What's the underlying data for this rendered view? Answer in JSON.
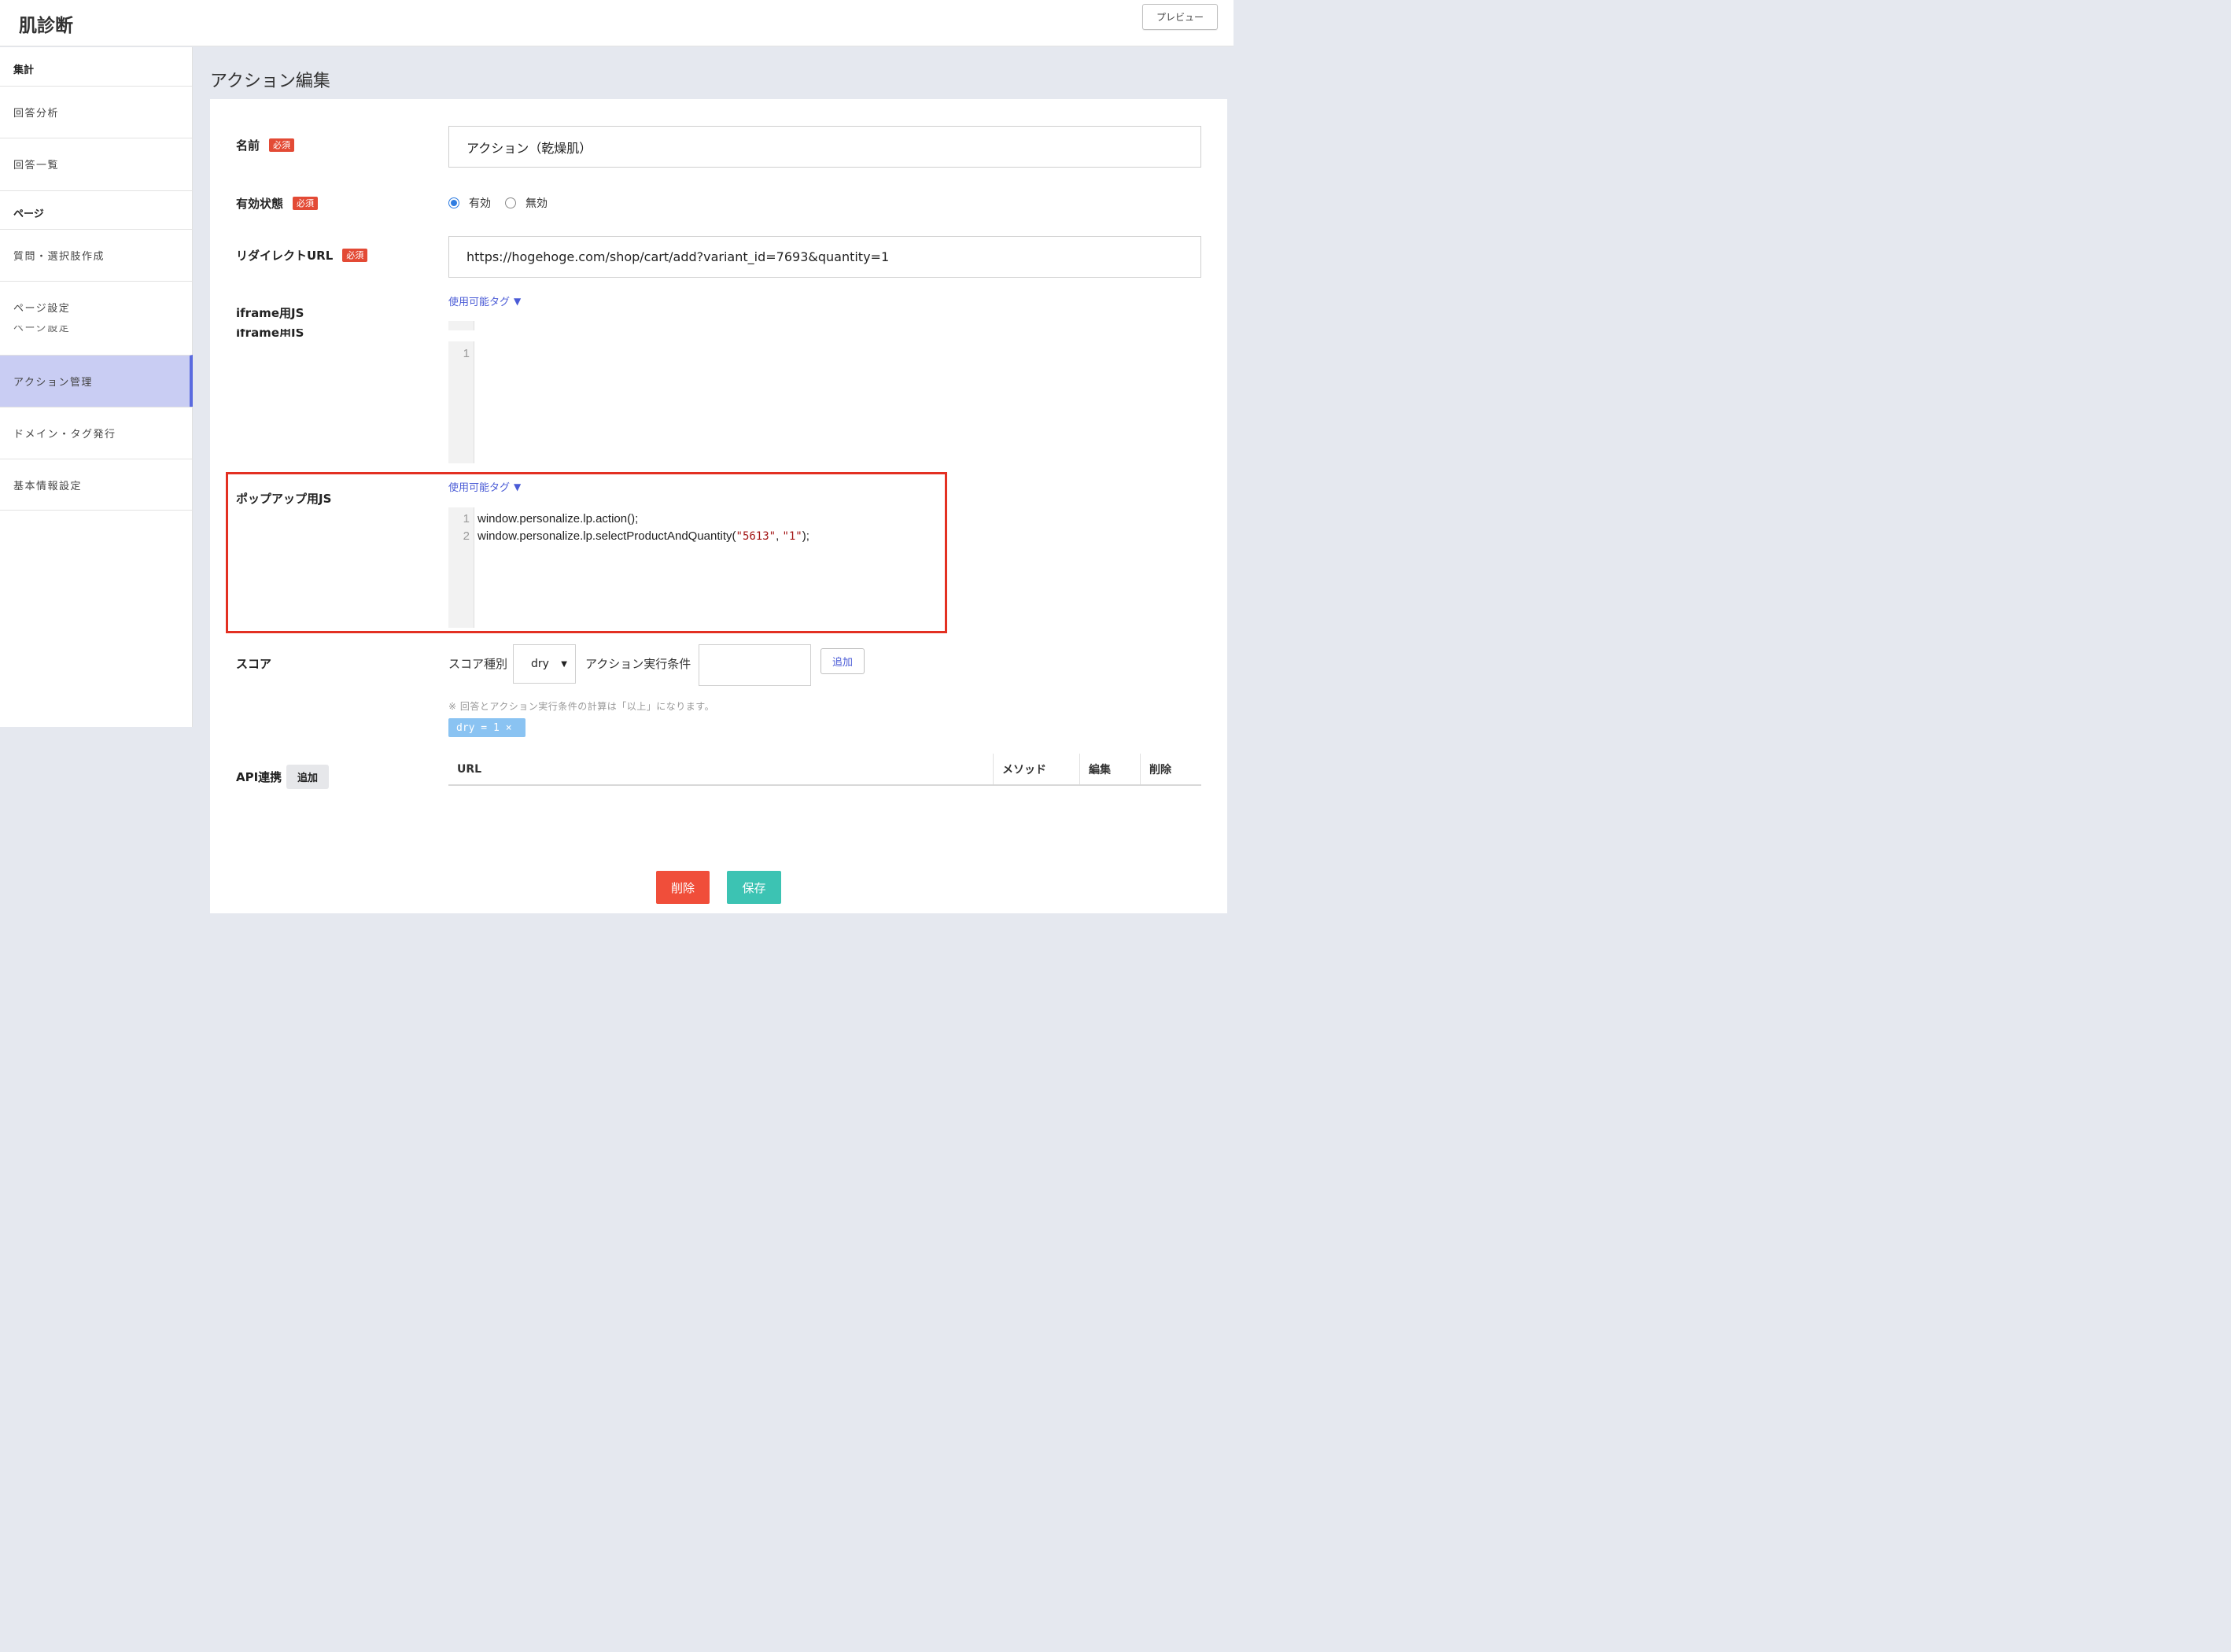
{
  "header": {
    "app_title": "肌診断",
    "preview_label": "プレビュー"
  },
  "sidebar": {
    "section_aggregate": "集計",
    "answer_analysis": "回答分析",
    "answer_list": "回答一覧",
    "section_page": "ページ",
    "question_create": "質問・選択肢作成",
    "page_settings": "ページ設定",
    "action_manage": "アクション管理",
    "domain_tag": "ドメイン・タグ発行",
    "basic_info": "基本情報設定"
  },
  "main": {
    "page_title": "アクション編集",
    "required_badge": "必須",
    "name_label": "名前",
    "name_value": "アクション（乾燥肌）",
    "status_label": "有効状態",
    "status_enabled": "有効",
    "status_disabled": "無効",
    "status_selected": "有効",
    "redirect_label": "リダイレクトURL",
    "redirect_value": "https://hogehoge.com/shop/cart/add?variant_id=7693&quantity=1",
    "iframe_label": "iframe用JS",
    "tags_link": "使用可能タグ",
    "iframe_line_numbers": [
      "1"
    ],
    "popup_label": "ポップアップ用JS",
    "popup_line_numbers": [
      "1",
      "2"
    ],
    "popup_code_line1": "window.personalize.lp.action();",
    "popup_code_line2_prefix": "window.personalize.lp.selectProductAndQuantity(",
    "popup_code_str1": "\"5613\"",
    "popup_code_sep": ", ",
    "popup_code_str2": "\"1\"",
    "popup_code_line2_suffix": ");",
    "score_label": "スコア",
    "score_type_label": "スコア種別",
    "score_type_value": "dry",
    "condition_label": "アクション実行条件",
    "condition_value": "",
    "add_label": "追加",
    "score_note": "※ 回答とアクション実行条件の計算は「以上」になります。",
    "score_chip": "dry = 1",
    "chip_remove": "×",
    "api_label": "API連携",
    "api_add": "追加",
    "table_headers": [
      "URL",
      "メソッド",
      "編集",
      "削除"
    ],
    "delete_button": "削除",
    "save_button": "保存"
  },
  "colors": {
    "accent": "#5b6bdf",
    "highlight": "#e33022",
    "danger": "#f04e3a",
    "save": "#3cc3b3",
    "chip": "#8ac3f2"
  }
}
